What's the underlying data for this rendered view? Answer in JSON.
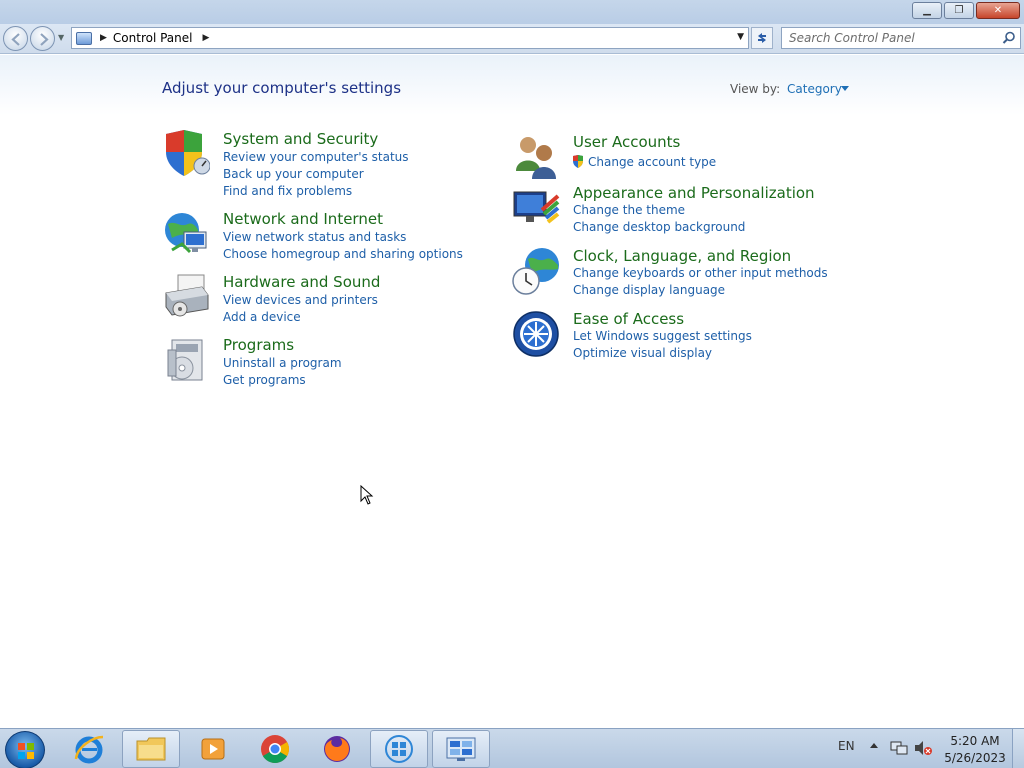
{
  "window": {
    "minimize_label": "▁",
    "maximize_label": "❐",
    "close_label": "✕"
  },
  "address_bar": {
    "location": "Control Panel",
    "icon": "control-panel-icon"
  },
  "search": {
    "placeholder": "Search Control Panel"
  },
  "page": {
    "heading": "Adjust your computer's settings",
    "view_by_label": "View by:",
    "view_by_value": "Category"
  },
  "categories": {
    "system_security": {
      "title": "System and Security",
      "icon": "shield-icon",
      "links": [
        "Review your computer's status",
        "Back up your computer",
        "Find and fix problems"
      ]
    },
    "network_internet": {
      "title": "Network and Internet",
      "icon": "network-globe-icon",
      "links": [
        "View network status and tasks",
        "Choose homegroup and sharing options"
      ]
    },
    "hardware_sound": {
      "title": "Hardware and Sound",
      "icon": "printer-icon",
      "links": [
        "View devices and printers",
        "Add a device"
      ]
    },
    "programs": {
      "title": "Programs",
      "icon": "programs-disc-icon",
      "links": [
        "Uninstall a program",
        "Get programs"
      ]
    },
    "user_accounts": {
      "title": "User Accounts",
      "icon": "users-icon",
      "links": [
        "Change account type"
      ]
    },
    "appearance": {
      "title": "Appearance and Personalization",
      "icon": "monitor-paint-icon",
      "links": [
        "Change the theme",
        "Change desktop background"
      ]
    },
    "clock_language": {
      "title": "Clock, Language, and Region",
      "icon": "clock-globe-icon",
      "links": [
        "Change keyboards or other input methods",
        "Change display language"
      ]
    },
    "ease_access": {
      "title": "Ease of Access",
      "icon": "ease-of-access-icon",
      "links": [
        "Let Windows suggest settings",
        "Optimize visual display"
      ]
    }
  },
  "taskbar": {
    "items": [
      "start-button",
      "internet-explorer-icon",
      "file-explorer-icon",
      "media-player-icon",
      "chrome-icon",
      "firefox-icon",
      "windows-logo-icon",
      "control-panel-icon"
    ],
    "language": "EN",
    "time": "5:20 AM",
    "date": "5/26/2023"
  },
  "colors": {
    "category_title": "#1b6b1b",
    "link": "#1e5fa8",
    "heading": "#1e3287"
  }
}
